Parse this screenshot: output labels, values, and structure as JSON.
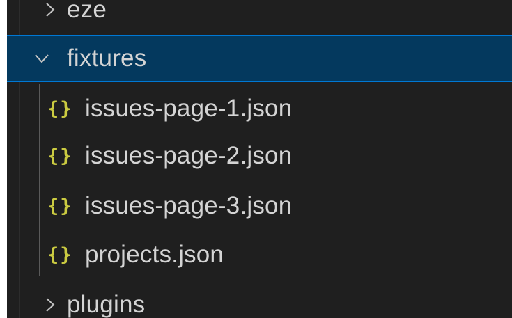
{
  "explorer": {
    "items": [
      {
        "label": "eze",
        "type": "folder",
        "expanded": false,
        "icon": "chevron-right-icon"
      },
      {
        "label": "fixtures",
        "type": "folder",
        "expanded": true,
        "selected": true,
        "icon": "chevron-down-icon"
      },
      {
        "label": "issues-page-1.json",
        "type": "file",
        "icon": "json-file-icon",
        "icon_glyph": "{}"
      },
      {
        "label": "issues-page-2.json",
        "type": "file",
        "icon": "json-file-icon",
        "icon_glyph": "{}"
      },
      {
        "label": "issues-page-3.json",
        "type": "file",
        "icon": "json-file-icon",
        "icon_glyph": "{}"
      },
      {
        "label": "projects.json",
        "type": "file",
        "icon": "json-file-icon",
        "icon_glyph": "{}"
      },
      {
        "label": "plugins",
        "type": "folder",
        "expanded": false,
        "icon": "chevron-right-icon"
      }
    ],
    "colors": {
      "background": "#1f1f1f",
      "selected_background": "#04395e",
      "selected_border": "#0078d4",
      "text": "#d4d4d4",
      "json_icon": "#cbcb41"
    }
  }
}
